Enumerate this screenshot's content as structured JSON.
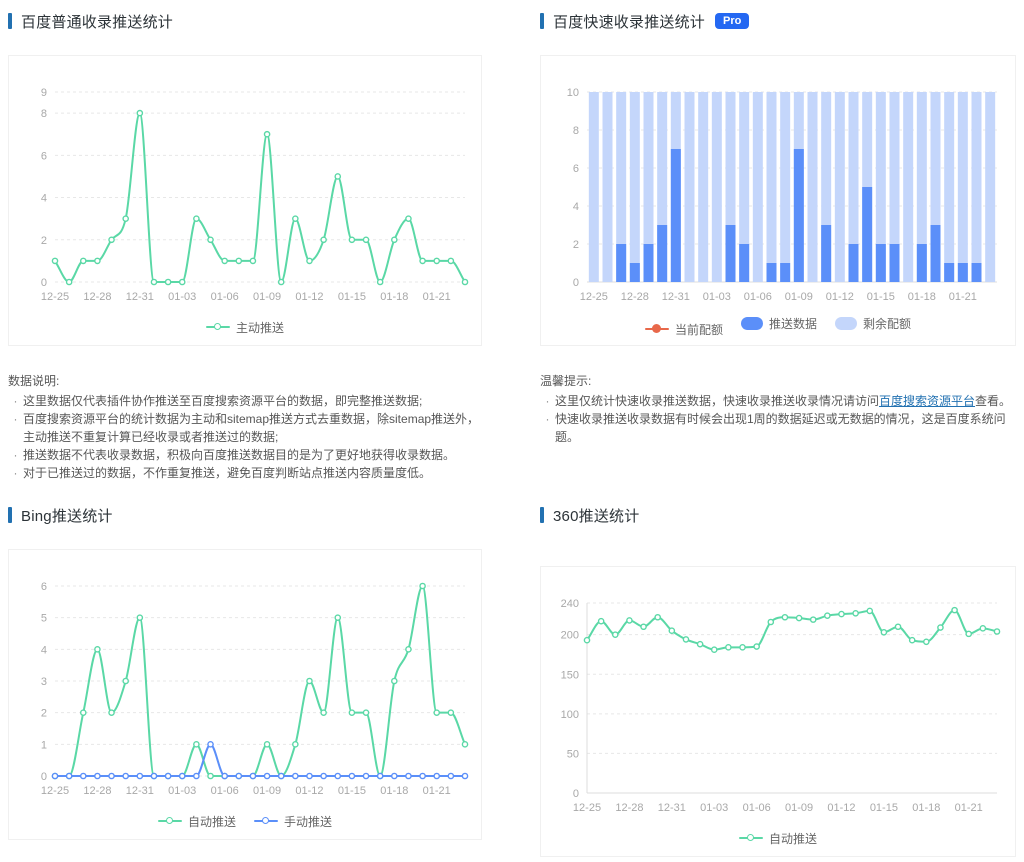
{
  "colors": {
    "accent": "#2271b1",
    "badge_bg": "#2468f2",
    "green": "#5AD8A6",
    "blue": "#5B8FF9",
    "light_blue": "#c4d6fb",
    "red": "#E8684A",
    "link": "#2271b1"
  },
  "sections": {
    "baidu_normal": {
      "title": "百度普通收录推送统计"
    },
    "baidu_fast": {
      "title": "百度快速收录推送统计",
      "badge": "Pro"
    },
    "bing": {
      "title": "Bing推送统计"
    },
    "so360": {
      "title": "360推送统计"
    }
  },
  "notes_left": {
    "heading": "数据说明:",
    "items": [
      {
        "text": "这里数据仅代表插件协作推送至百度搜索资源平台的数据，即完整推送数据;"
      },
      {
        "text": "百度搜索资源平台的统计数据为主动和sitemap推送方式去重数据，除sitemap推送外，主动推送不重复计算已经收录或者推送过的数据;"
      },
      {
        "text": "推送数据不代表收录数据，积极向百度推送数据目的是为了更好地获得收录数据。"
      },
      {
        "text": "对于已推送过的数据，不作重复推送，避免百度判断站点推送内容质量度低。"
      }
    ]
  },
  "notes_right": {
    "heading": "温馨提示:",
    "items": [
      {
        "pre": "这里仅统计快速收录推送数据，快速收录推送收录情况请访问",
        "link": "百度搜索资源平台",
        "post": "查看。"
      },
      {
        "text": "快速收录推送收录数据有时候会出现1周的数据延迟或无数据的情况，这是百度系统问题。"
      }
    ]
  },
  "chart_data": [
    {
      "id": "baidu-normal-push",
      "type": "line",
      "title": "百度普通收录推送统计",
      "categories": [
        "12-25",
        "12-26",
        "12-27",
        "12-28",
        "12-29",
        "12-30",
        "12-31",
        "01-01",
        "01-02",
        "01-03",
        "01-04",
        "01-05",
        "01-06",
        "01-07",
        "01-08",
        "01-09",
        "01-10",
        "01-11",
        "01-12",
        "01-13",
        "01-14",
        "01-15",
        "01-16",
        "01-17",
        "01-18",
        "01-19",
        "01-20",
        "01-21",
        "01-22",
        "01-23"
      ],
      "series": [
        {
          "name": "主动推送",
          "color": "#5AD8A6",
          "swatch": "line",
          "values": [
            1,
            0,
            1,
            1,
            2,
            3,
            8,
            0,
            0,
            0,
            3,
            2,
            1,
            1,
            1,
            7,
            0,
            3,
            1,
            2,
            5,
            2,
            2,
            0,
            2,
            3,
            1,
            1,
            1,
            0
          ]
        }
      ],
      "ylim": [
        0,
        9
      ],
      "yticks": [
        0,
        2,
        4,
        6,
        8,
        9
      ],
      "xtick_every": 3,
      "grid": "dashed",
      "legend_position": "bottom"
    },
    {
      "id": "baidu-fast-push",
      "type": "bar",
      "title": "百度快速收录推送统计",
      "categories": [
        "12-25",
        "12-26",
        "12-27",
        "12-28",
        "12-29",
        "12-30",
        "12-31",
        "01-01",
        "01-02",
        "01-03",
        "01-04",
        "01-05",
        "01-06",
        "01-07",
        "01-08",
        "01-09",
        "01-10",
        "01-11",
        "01-12",
        "01-13",
        "01-14",
        "01-15",
        "01-16",
        "01-17",
        "01-18",
        "01-19",
        "01-20",
        "01-21",
        "01-22",
        "01-23"
      ],
      "quota": 10,
      "series": [
        {
          "name": "当前配额",
          "color": "#E8684A",
          "swatch": "dot-line",
          "legend_only": true,
          "values": []
        },
        {
          "name": "推送数据",
          "color": "#5B8FF9",
          "swatch": "pill",
          "values": [
            0,
            0,
            2,
            1,
            2,
            3,
            7,
            0,
            0,
            0,
            3,
            2,
            0,
            1,
            1,
            7,
            0,
            3,
            0,
            2,
            5,
            2,
            2,
            0,
            2,
            3,
            1,
            1,
            1,
            0
          ]
        },
        {
          "name": "剩余配额",
          "color": "#c4d6fb",
          "swatch": "pill",
          "role": "background",
          "values": [
            10,
            10,
            8,
            9,
            8,
            7,
            3,
            10,
            10,
            10,
            7,
            8,
            10,
            9,
            9,
            3,
            10,
            7,
            10,
            8,
            5,
            8,
            8,
            10,
            8,
            7,
            9,
            9,
            9,
            10
          ]
        }
      ],
      "ylim": [
        0,
        10
      ],
      "yticks": [
        0,
        2,
        4,
        6,
        8,
        10
      ],
      "xtick_every": 3,
      "grid": "dashed",
      "axis_lines": [
        "bottom"
      ],
      "legend_position": "bottom"
    },
    {
      "id": "bing-push",
      "type": "line",
      "title": "Bing推送统计",
      "categories": [
        "12-25",
        "12-26",
        "12-27",
        "12-28",
        "12-29",
        "12-30",
        "12-31",
        "01-01",
        "01-02",
        "01-03",
        "01-04",
        "01-05",
        "01-06",
        "01-07",
        "01-08",
        "01-09",
        "01-10",
        "01-11",
        "01-12",
        "01-13",
        "01-14",
        "01-15",
        "01-16",
        "01-17",
        "01-18",
        "01-19",
        "01-20",
        "01-21",
        "01-22",
        "01-23"
      ],
      "series": [
        {
          "name": "自动推送",
          "color": "#5AD8A6",
          "swatch": "line",
          "values": [
            0,
            0,
            2,
            4,
            2,
            3,
            5,
            0,
            0,
            0,
            1,
            0,
            0,
            0,
            0,
            1,
            0,
            1,
            3,
            2,
            5,
            2,
            2,
            0,
            3,
            4,
            6,
            2,
            2,
            1
          ]
        },
        {
          "name": "手动推送",
          "color": "#5B8FF9",
          "swatch": "line",
          "values": [
            0,
            0,
            0,
            0,
            0,
            0,
            0,
            0,
            0,
            0,
            0,
            1,
            0,
            0,
            0,
            0,
            0,
            0,
            0,
            0,
            0,
            0,
            0,
            0,
            0,
            0,
            0,
            0,
            0,
            0
          ]
        }
      ],
      "ylim": [
        0,
        6
      ],
      "yticks": [
        0,
        1,
        2,
        3,
        4,
        5,
        6
      ],
      "xtick_every": 3,
      "grid": "dashed",
      "legend_position": "bottom"
    },
    {
      "id": "360-push",
      "type": "line",
      "title": "360推送统计",
      "categories": [
        "12-25",
        "12-26",
        "12-27",
        "12-28",
        "12-29",
        "12-30",
        "12-31",
        "01-01",
        "01-02",
        "01-03",
        "01-04",
        "01-05",
        "01-06",
        "01-07",
        "01-08",
        "01-09",
        "01-10",
        "01-11",
        "01-12",
        "01-13",
        "01-14",
        "01-15",
        "01-16",
        "01-17",
        "01-18",
        "01-19",
        "01-20",
        "01-21",
        "01-22",
        "01-23"
      ],
      "series": [
        {
          "name": "自动推送",
          "color": "#5AD8A6",
          "swatch": "line",
          "values": [
            193,
            217,
            200,
            218,
            210,
            222,
            205,
            194,
            188,
            181,
            184,
            184,
            185,
            216,
            222,
            221,
            219,
            224,
            226,
            227,
            230,
            203,
            210,
            193,
            191,
            209,
            231,
            201,
            208,
            204
          ]
        }
      ],
      "ylim": [
        0,
        240
      ],
      "yticks": [
        0,
        50,
        100,
        150,
        200,
        240
      ],
      "xtick_every": 3,
      "grid": "dashed",
      "axis_lines": [
        "left",
        "bottom"
      ],
      "legend_position": "bottom"
    }
  ]
}
